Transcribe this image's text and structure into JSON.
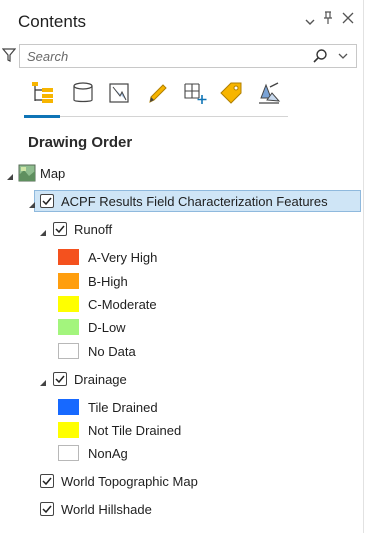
{
  "pane": {
    "title": "Contents",
    "buttons": {
      "dropdown": "⌄",
      "pin": "†",
      "close": "×"
    }
  },
  "search": {
    "placeholder": "Search",
    "value": ""
  },
  "toolbar": {
    "tools": [
      {
        "name": "list-by-drawing-order",
        "active": true
      },
      {
        "name": "list-by-data-source",
        "active": false
      },
      {
        "name": "list-by-selection",
        "active": false
      },
      {
        "name": "list-by-editing",
        "active": false
      },
      {
        "name": "list-by-snapping",
        "active": false
      },
      {
        "name": "list-by-labeling",
        "active": false
      },
      {
        "name": "list-by-perspective-imagery",
        "active": false
      }
    ]
  },
  "section_title": "Drawing Order",
  "tree": {
    "map": {
      "label": "Map"
    },
    "acpf_layer": {
      "label": "ACPF Results Field Characterization Features",
      "checked": true
    },
    "runoff": {
      "label": "Runoff",
      "checked": true,
      "classes": [
        {
          "label": "A-Very High",
          "color": "#f4511e"
        },
        {
          "label": "B-High",
          "color": "#ff9e0e"
        },
        {
          "label": "C-Moderate",
          "color": "#ffff00"
        },
        {
          "label": "D-Low",
          "color": "#a3f57d"
        },
        {
          "label": "No Data",
          "color": "#ffffff"
        }
      ]
    },
    "drainage": {
      "label": "Drainage",
      "checked": true,
      "classes": [
        {
          "label": "Tile Drained",
          "color": "#1769ff"
        },
        {
          "label": "Not Tile Drained",
          "color": "#ffff00"
        },
        {
          "label": "NonAg",
          "color": "#ffffff"
        }
      ]
    },
    "basemaps": [
      {
        "label": "World Topographic Map",
        "checked": true
      },
      {
        "label": "World Hillshade",
        "checked": true
      }
    ]
  },
  "colors": {
    "accent": "#0f74b6",
    "selection_bg": "#cfe5f6",
    "selection_border": "#8fb9dd"
  }
}
